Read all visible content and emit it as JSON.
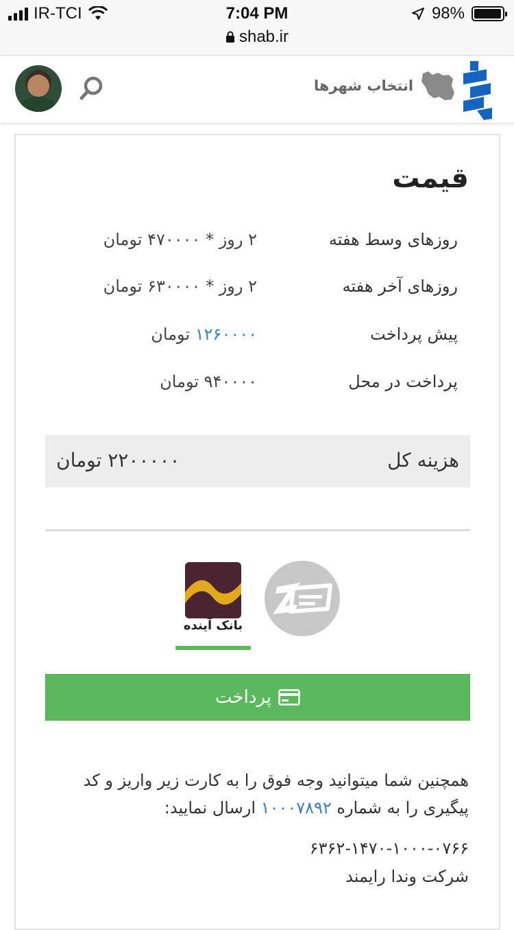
{
  "status_bar": {
    "carrier": "IR-TCI",
    "time": "7:04 PM",
    "url": "shab.ir",
    "battery": "98%",
    "battery_level": 0.98
  },
  "header": {
    "city_select_label": "انتخاب شهرها"
  },
  "price": {
    "title": "قیمت",
    "rows": [
      {
        "label": "روزهای وسط هفته",
        "value": "۲ روز * ۴۷۰۰۰۰ تومان"
      },
      {
        "label": "روزهای آخر هفته",
        "value": "۲ روز * ۶۳۰۰۰۰ تومان"
      },
      {
        "label": "پیش پرداخت",
        "amount": "۱۲۶۰۰۰۰",
        "unit": "تومان"
      },
      {
        "label": "پرداخت در محل",
        "value": "۹۴۰۰۰۰ تومان"
      }
    ],
    "total_label": "هزینه کل",
    "total_value": "۲۲۰۰۰۰۰ تومان"
  },
  "gateways": {
    "ayandeh_text": "بانک آینده",
    "selected": "ayandeh"
  },
  "pay_button_label": "پرداخت",
  "note": {
    "text_before": "همچنین شما میتوانید وجه فوق را به کارت زیر واریز و کد پیگیری را به شماره",
    "phone": "۱۰۰۰۷۸۹۲",
    "text_after": "ارسال نمایید:",
    "card_number": "۶۳۶۲-۱۴۷۰-۱۰۰۰-۰۷۶۶",
    "company": "شرکت وندا رایمند"
  },
  "colors": {
    "accent_blue": "#3a7fc1",
    "pay_green": "#5cb85c",
    "logo_blue": "#1565c0"
  }
}
